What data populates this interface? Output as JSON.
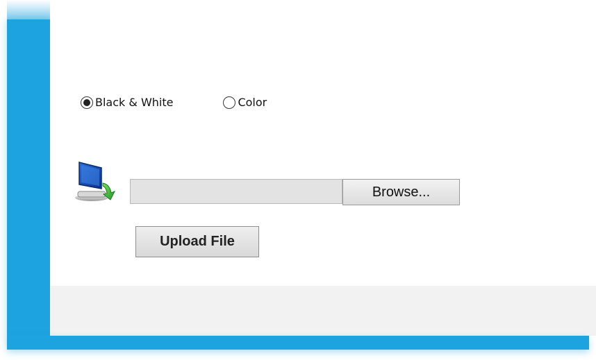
{
  "color_mode": {
    "options": [
      {
        "label": "Black & White",
        "selected": true
      },
      {
        "label": "Color",
        "selected": false
      }
    ]
  },
  "file_input": {
    "value": "",
    "browse_label": "Browse..."
  },
  "upload": {
    "button_label": "Upload File"
  },
  "icons": {
    "upload_icon": "computer-upload-icon"
  },
  "colors": {
    "accent": "#1da3e0",
    "footer_background": "#f2f2f2"
  }
}
